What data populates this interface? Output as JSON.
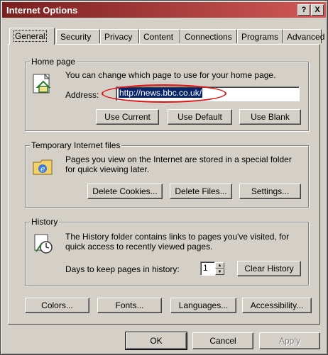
{
  "window": {
    "title": "Internet Options",
    "help_btn": "?",
    "close_btn": "X"
  },
  "tabs": [
    {
      "label": "General",
      "active": true
    },
    {
      "label": "Security"
    },
    {
      "label": "Privacy"
    },
    {
      "label": "Content"
    },
    {
      "label": "Connections"
    },
    {
      "label": "Programs"
    },
    {
      "label": "Advanced"
    }
  ],
  "home_page": {
    "legend": "Home page",
    "description": "You can change which page to use for your home page.",
    "address_label": "Address:",
    "address_value": "http://news.bbc.co.uk/",
    "use_current": "Use Current",
    "use_default": "Use Default",
    "use_blank": "Use Blank"
  },
  "temp_files": {
    "legend": "Temporary Internet files",
    "description_line1": "Pages you view on the Internet are stored in a special folder",
    "description_line2": "for quick viewing later.",
    "delete_cookies": "Delete Cookies...",
    "delete_files": "Delete Files...",
    "settings": "Settings..."
  },
  "history": {
    "legend": "History",
    "description_line1": "The History folder contains links to pages you've visited, for",
    "description_line2": "quick access to recently viewed pages.",
    "days_label": "Days to keep pages in history:",
    "days_value": "1",
    "clear_history": "Clear History"
  },
  "bottom_buttons": {
    "colors": "Colors...",
    "fonts": "Fonts...",
    "languages": "Languages...",
    "accessibility": "Accessibility..."
  },
  "dialog_buttons": {
    "ok": "OK",
    "cancel": "Cancel",
    "apply": "Apply"
  },
  "icons": {
    "home": "home-page-icon",
    "temp": "internet-explorer-folder-icon",
    "history": "history-clock-icon"
  },
  "colors": {
    "title_start": "#7a1f1f",
    "title_end": "#d25858",
    "face": "#d4d0c8",
    "highlight": "#e01010"
  }
}
